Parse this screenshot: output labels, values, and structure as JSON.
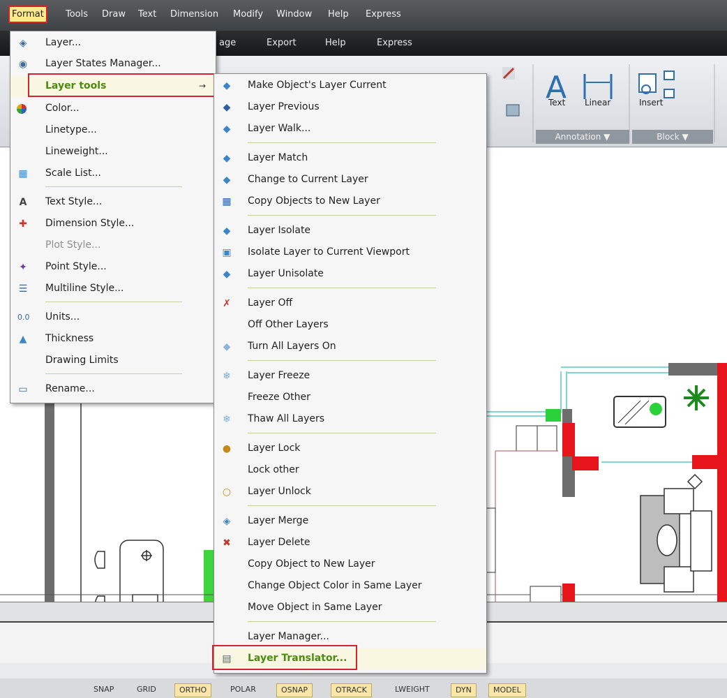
{
  "menubar": {
    "items": [
      "Format",
      "Tools",
      "Draw",
      "Text",
      "Dimension",
      "Modify",
      "Window",
      "Help",
      "Express"
    ]
  },
  "ribbon_tabs": [
    "age",
    "Export",
    "Help",
    "Express"
  ],
  "ribbon": {
    "text_label": "Text",
    "linear_label": "Linear",
    "insert_label": "Insert",
    "annotation_panel": "Annotation ▼",
    "block_panel": "Block ▼"
  },
  "format_menu": {
    "items": [
      {
        "label": "Layer...",
        "icon": "layer-icon"
      },
      {
        "label": "Layer States Manager...",
        "icon": "layer-states-icon"
      },
      {
        "label": "Layer tools",
        "icon": "",
        "submenu_arrow": "→"
      },
      {
        "label": "Color...",
        "icon": "color-wheel-icon"
      },
      {
        "label": "Linetype...",
        "icon": ""
      },
      {
        "label": "Lineweight...",
        "icon": ""
      },
      {
        "label": "Scale List...",
        "icon": "scale-list-icon"
      },
      {
        "label": "Text Style...",
        "icon": "text-style-icon"
      },
      {
        "label": "Dimension Style...",
        "icon": "dimension-style-icon"
      },
      {
        "label": "Plot Style...",
        "icon": ""
      },
      {
        "label": "Point Style...",
        "icon": "point-style-icon"
      },
      {
        "label": "Multiline Style...",
        "icon": "multiline-style-icon"
      },
      {
        "label": "Units...",
        "icon": "units-icon"
      },
      {
        "label": "Thickness",
        "icon": "thickness-icon"
      },
      {
        "label": "Drawing Limits",
        "icon": ""
      },
      {
        "label": "Rename...",
        "icon": "rename-icon"
      }
    ]
  },
  "layer_tools_menu": {
    "items": [
      "Make Object's Layer Current",
      "Layer Previous",
      "Layer Walk...",
      "Layer Match",
      "Change to Current Layer",
      "Copy Objects to New Layer",
      "Layer Isolate",
      "Isolate Layer to Current Viewport",
      "Layer Unisolate",
      "Layer Off",
      "Off Other Layers",
      "Turn All Layers On",
      "Layer Freeze",
      "Freeze Other",
      "Thaw All Layers",
      "Layer Lock",
      "Lock other",
      "Layer Unlock",
      "Layer Merge",
      "Layer Delete",
      "Copy Object to New Layer",
      "Change Object Color in Same Layer",
      "Move Object in Same Layer",
      "Layer Manager...",
      "Layer Translator..."
    ]
  },
  "statusbar": {
    "items": [
      "SNAP",
      "GRID",
      "ORTHO",
      "POLAR",
      "OSNAP",
      "OTRACK",
      "LWEIGHT",
      "DYN",
      "MODEL"
    ]
  },
  "colors": {
    "highlight_border": "#d4232a",
    "active_menu_bg": "#ffe98a",
    "green_text": "#4d8a12",
    "wall_red": "#e8141c"
  }
}
